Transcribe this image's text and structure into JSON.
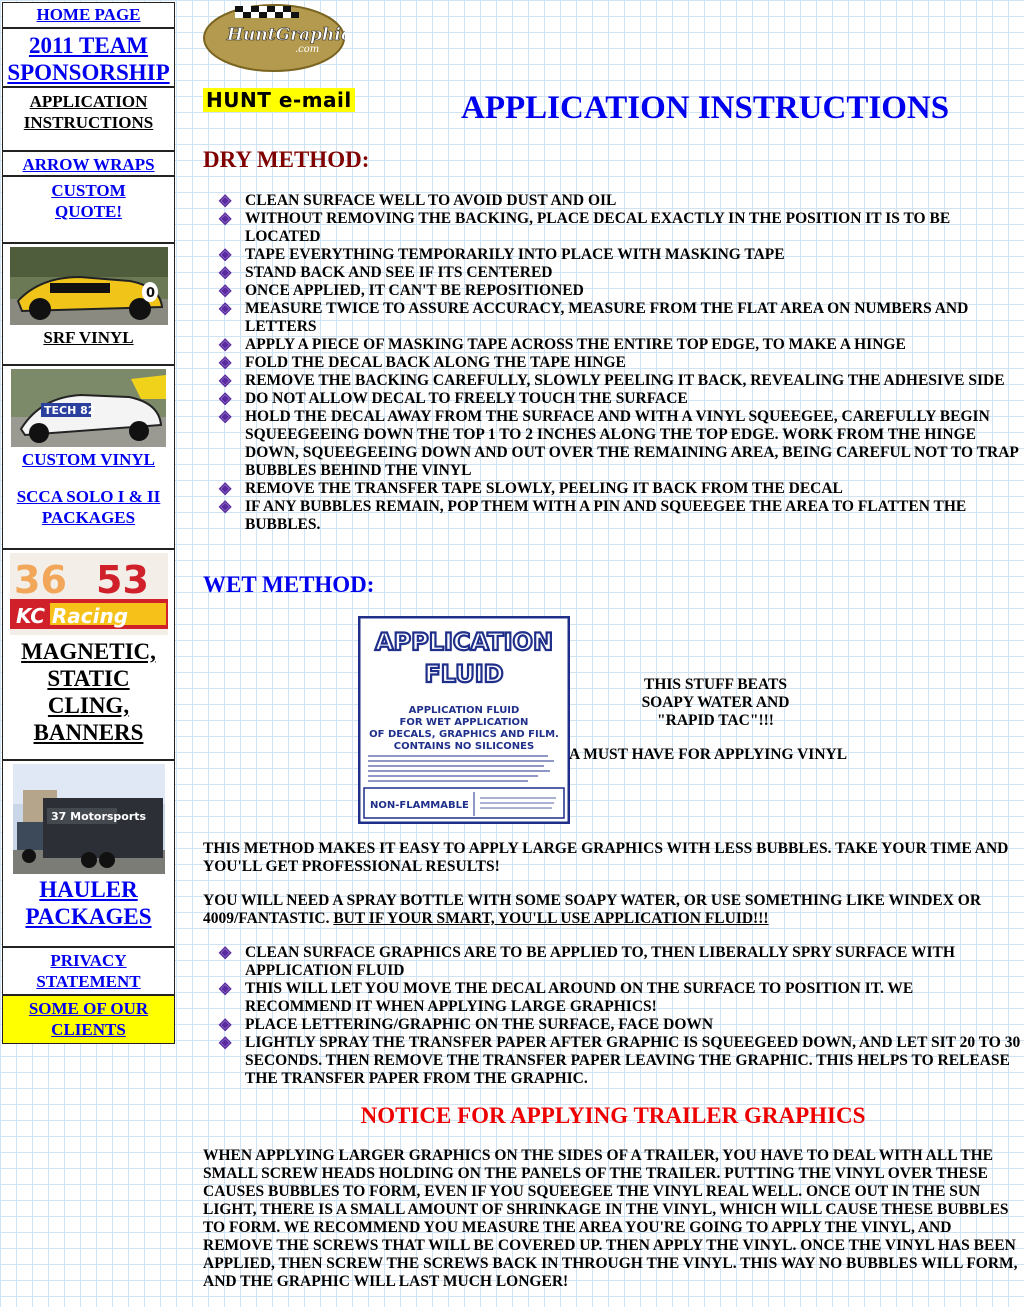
{
  "sidebar": {
    "home": "HOME PAGE",
    "team": "2011 TEAM SPONSORSHIP",
    "app_instructions": "APPLICATION INSTRUCTIONS",
    "arrow_wraps": "ARROW WRAPS",
    "custom_quote": "CUSTOM QUOTE!",
    "srf_vinyl": "SRF VINYL",
    "custom_vinyl": "CUSTOM VINYL",
    "scca": "SCCA SOLO I & II PACKAGES",
    "magnetic": "MAGNETIC, STATIC CLING, BANNERS",
    "hauler": "HAULER PACKAGES",
    "privacy": "PRIVACY STATEMENT",
    "clients": "SOME OF OUR CLIENTS",
    "thumb_srf_number": "0",
    "thumb_tech_text": "TECH 82",
    "thumb_kc_numbers": [
      "36",
      "53"
    ],
    "thumb_kc_text": "KC Racing",
    "thumb_hauler_text": "37 Motorsports"
  },
  "header": {
    "logo_text": "HuntGraphic",
    "logo_sub": ".com",
    "hunt_email": "HUNT e-mail",
    "title": "APPLICATION INSTRUCTIONS"
  },
  "dry": {
    "heading": "DRY METHOD:",
    "items": [
      "CLEAN SURFACE WELL TO AVOID DUST AND OIL",
      "WITHOUT REMOVING THE BACKING, PLACE DECAL EXACTLY IN THE POSITION IT IS TO BE LOCATED",
      "TAPE EVERYTHING TEMPORARILY INTO PLACE WITH MASKING TAPE",
      "STAND BACK AND SEE IF ITS CENTERED",
      "ONCE APPLIED, IT CAN'T BE REPOSITIONED",
      "MEASURE TWICE TO ASSURE ACCURACY, MEASURE FROM THE FLAT AREA ON NUMBERS AND LETTERS",
      "APPLY A PIECE OF MASKING TAPE ACROSS THE ENTIRE TOP EDGE, TO MAKE A HINGE",
      "FOLD THE DECAL BACK ALONG THE TAPE HINGE",
      "REMOVE THE BACKING CAREFULLY, SLOWLY PEELING IT BACK, REVEALING THE ADHESIVE SIDE",
      "DO NOT ALLOW DECAL TO FREELY TOUCH THE SURFACE",
      "HOLD THE DECAL AWAY FROM THE SURFACE AND WITH A VINYL SQUEEGEE, CAREFULLY BEGIN SQUEEGEEING DOWN THE TOP 1 TO 2 INCHES ALONG THE TOP EDGE. WORK FROM THE HINGE DOWN, SQUEEGEEING DOWN AND OUT OVER THE REMAINING AREA, BEING CAREFUL NOT TO TRAP BUBBLES BEHIND THE VINYL",
      "REMOVE THE TRANSFER TAPE SLOWLY, PEELING IT BACK FROM THE DECAL",
      "IF ANY BUBBLES REMAIN, POP THEM WITH A PIN AND SQUEEGEE THE AREA TO FLATTEN THE BUBBLES."
    ]
  },
  "wet": {
    "heading": "WET METHOD:",
    "label_title_1": "APPLICATION",
    "label_title_2": "FLUID",
    "label_line_1": "APPLICATION FLUID",
    "label_line_2": "FOR WET APPLICATION",
    "label_line_3": "OF DECALS, GRAPHICS AND FILM.",
    "label_line_4": "CONTAINS NO SILICONES",
    "label_nonflammable": "NON-FLAMMABLE",
    "caption_1": "THIS STUFF BEATS",
    "caption_2": "SOAPY WATER AND",
    "caption_3": "\"RAPID TAC\"!!!",
    "caption_4": "A MUST HAVE FOR APPLYING VINYL",
    "para1": "THIS METHOD MAKES IT EASY TO APPLY LARGE GRAPHICS WITH LESS BUBBLES. TAKE YOUR TIME AND YOU'LL GET PROFESSIONAL RESULTS!",
    "para2_a": "YOU WILL NEED A SPRAY BOTTLE WITH SOME SOAPY WATER, OR USE SOMETHING LIKE WINDEX OR 4009/FANTASTIC. ",
    "para2_b": "BUT IF YOUR SMART, YOU'LL USE APPLICATION FLUID!!!",
    "items": [
      "CLEAN SURFACE GRAPHICS ARE TO BE APPLIED TO, THEN LIBERALLY SPRY SURFACE WITH APPLICATION FLUID",
      "THIS  WILL LET YOU MOVE THE DECAL AROUND ON THE SURFACE TO POSITION IT. WE RECOMMEND IT WHEN APPLYING LARGE GRAPHICS!",
      "PLACE LETTERING/GRAPHIC ON THE SURFACE, FACE DOWN",
      "LIGHTLY SPRAY THE TRANSFER PAPER AFTER GRAPHIC IS SQUEEGEED DOWN, AND LET SIT 20 TO 30 SECONDS. THEN REMOVE THE TRANSFER PAPER LEAVING THE GRAPHIC. THIS  HELPS TO RELEASE THE TRANSFER PAPER FROM THE GRAPHIC."
    ]
  },
  "notice": {
    "heading": "NOTICE FOR APPLYING TRAILER GRAPHICS",
    "body": "WHEN APPLYING LARGER GRAPHICS ON THE SIDES OF A TRAILER, YOU HAVE TO DEAL WITH ALL THE SMALL SCREW HEADS HOLDING ON THE PANELS OF THE TRAILER. PUTTING THE VINYL OVER THESE CAUSES BUBBLES TO FORM, EVEN IF YOU SQUEEGEE THE VINYL REAL WELL. ONCE OUT IN THE SUN LIGHT, THERE IS A SMALL AMOUNT OF SHRINKAGE IN THE VINYL, WHICH WILL CAUSE THESE BUBBLES TO FORM. WE RECOMMEND YOU MEASURE THE AREA YOU'RE GOING TO APPLY THE VINYL, AND REMOVE THE SCREWS THAT WILL BE COVERED UP. THEN APPLY THE VINYL. ONCE THE VINYL HAS BEEN APPLIED, THEN SCREW THE SCREWS BACK IN THROUGH THE VINYL. THIS WAY NO BUBBLES WILL FORM, AND THE GRAPHIC WILL LAST MUCH LONGER!"
  },
  "colors": {
    "link": "#0000ee",
    "dry_heading": "#800000",
    "wet_heading": "#0000ee",
    "notice_heading": "#ee0000",
    "bullet": "#5a2aa0",
    "highlight": "#ffff00",
    "grid": "#cfe3f3"
  }
}
